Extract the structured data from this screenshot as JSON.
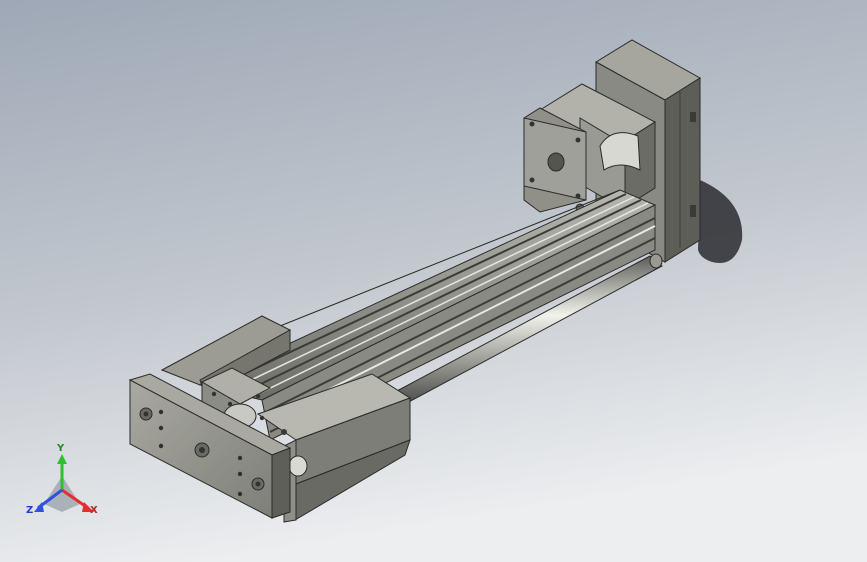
{
  "viewport": {
    "background_top": "#a3acb9",
    "background_bottom": "#e9ebee",
    "model_base_color": "#8e8e88"
  },
  "triad": {
    "x_label": "X",
    "y_label": "Y",
    "z_label": "Z",
    "x_color": "#e03030",
    "y_color": "#2fbf2f",
    "z_color": "#3050e0"
  },
  "parts": [
    "stepper-motor",
    "motor-mount-block",
    "aluminum-profile-rail",
    "guide-rod",
    "carriage-slider",
    "end-plate"
  ]
}
